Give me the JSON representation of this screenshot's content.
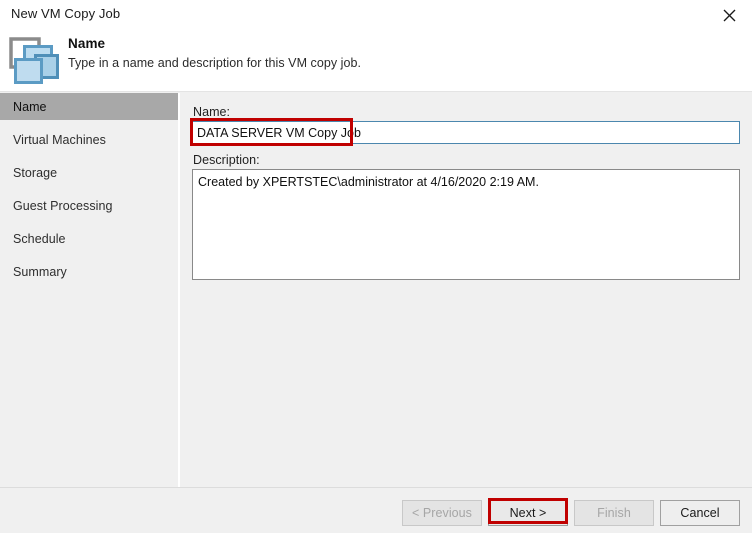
{
  "window": {
    "title": "New VM Copy Job",
    "close_icon": "close-icon"
  },
  "header": {
    "icon": "vm-copy-job-icon",
    "title": "Name",
    "subtitle": "Type in a name and description for this VM copy job."
  },
  "sidebar": {
    "items": [
      {
        "label": "Name",
        "selected": true
      },
      {
        "label": "Virtual Machines",
        "selected": false
      },
      {
        "label": "Storage",
        "selected": false
      },
      {
        "label": "Guest Processing",
        "selected": false
      },
      {
        "label": "Schedule",
        "selected": false
      },
      {
        "label": "Summary",
        "selected": false
      }
    ]
  },
  "form": {
    "name_label": "Name:",
    "name_value": "DATA SERVER VM Copy Job",
    "name_placeholder": "",
    "description_label": "Description:",
    "description_value": "Created by XPERTSTEC\\administrator at 4/16/2020 2:19 AM.",
    "description_placeholder": ""
  },
  "footer": {
    "previous_label": "< Previous",
    "next_label": "Next >",
    "finish_label": "Finish",
    "cancel_label": "Cancel"
  },
  "annotations": {
    "highlight_color": "#c00000",
    "name_field_highlight": "name-field",
    "next_button_highlight": "next-button"
  },
  "colors": {
    "selected_nav_bg": "#a8a8a8",
    "focus_border": "#4b87ae",
    "dialog_bg": "#f0f0f0"
  }
}
